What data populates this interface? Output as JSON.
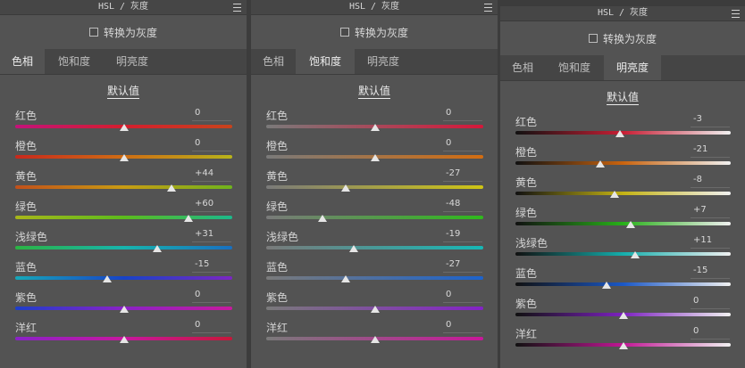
{
  "panel_title": "HSL / 灰度",
  "convert_label": "转换为灰度",
  "default_label": "默认值",
  "tabs": [
    "色相",
    "饱和度",
    "明亮度"
  ],
  "panels": [
    {
      "active_tab": "色相",
      "rows": [
        {
          "label": "红色",
          "value": "0",
          "level": 0
        },
        {
          "label": "橙色",
          "value": "0",
          "level": 0
        },
        {
          "label": "黄色",
          "value": "+44",
          "level": 44
        },
        {
          "label": "绿色",
          "value": "+60",
          "level": 60
        },
        {
          "label": "浅绿色",
          "value": "+31",
          "level": 31
        },
        {
          "label": "蓝色",
          "value": "-15",
          "level": -15
        },
        {
          "label": "紫色",
          "value": "0",
          "level": 0
        },
        {
          "label": "洋红",
          "value": "0",
          "level": 0
        }
      ]
    },
    {
      "active_tab": "饱和度",
      "rows": [
        {
          "label": "红色",
          "value": "0",
          "level": 0
        },
        {
          "label": "橙色",
          "value": "0",
          "level": 0
        },
        {
          "label": "黄色",
          "value": "-27",
          "level": -27
        },
        {
          "label": "绿色",
          "value": "-48",
          "level": -48
        },
        {
          "label": "浅绿色",
          "value": "-19",
          "level": -19
        },
        {
          "label": "蓝色",
          "value": "-27",
          "level": -27
        },
        {
          "label": "紫色",
          "value": "0",
          "level": 0
        },
        {
          "label": "洋红",
          "value": "0",
          "level": 0
        }
      ]
    },
    {
      "active_tab": "明亮度",
      "rows": [
        {
          "label": "红色",
          "value": "-3",
          "level": -3
        },
        {
          "label": "橙色",
          "value": "-21",
          "level": -21
        },
        {
          "label": "黄色",
          "value": "-8",
          "level": -8
        },
        {
          "label": "绿色",
          "value": "+7",
          "level": 7
        },
        {
          "label": "浅绿色",
          "value": "+11",
          "level": 11
        },
        {
          "label": "蓝色",
          "value": "-15",
          "level": -15
        },
        {
          "label": "紫色",
          "value": "0",
          "level": 0
        },
        {
          "label": "洋红",
          "value": "0",
          "level": 0
        }
      ]
    }
  ],
  "colors": {
    "panel_bg": "#535353",
    "tab_bar_bg": "#454545",
    "slider_thumb": "#e6e6e6"
  }
}
